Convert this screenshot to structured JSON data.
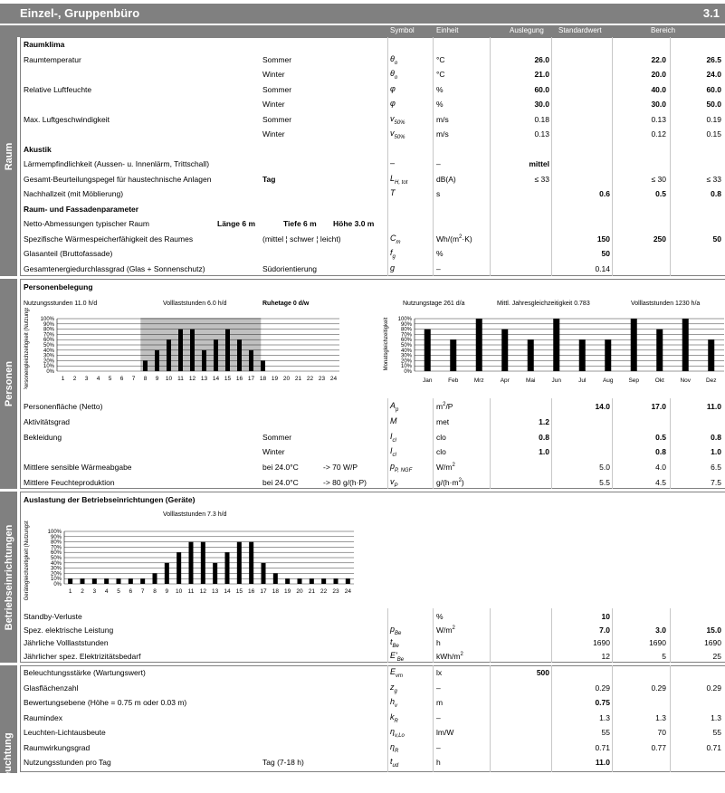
{
  "title": "Einzel-, Gruppenbüro",
  "number": "3.1",
  "headers": {
    "symbol": "Symbol",
    "einheit": "Einheit",
    "auslegung": "Auslegung",
    "standard": "Standardwert",
    "bereich": "Bereich"
  },
  "sides": [
    "Raum",
    "Personen",
    "Betriebseinrichtungen",
    "Beleuchtung"
  ],
  "raum_rows": [
    {
      "label": "Raumklima",
      "bold": true
    },
    {
      "label": "Raumtemperatur",
      "sub": "Sommer",
      "sym": "θ o",
      "unit": "°C",
      "ausl": "26.0",
      "ausl_b": true,
      "lo": "22.0",
      "hi": "26.5",
      "rb": true
    },
    {
      "label": "",
      "sub": "Winter",
      "sym": "θ o",
      "unit": "°C",
      "ausl": "21.0",
      "ausl_b": true,
      "lo": "20.0",
      "hi": "24.0",
      "rb": true
    },
    {
      "label": "Relative Luftfeuchte",
      "sub": "Sommer",
      "sym": "φ",
      "unit": "%",
      "ausl": "60.0",
      "ausl_b": true,
      "lo": "40.0",
      "hi": "60.0",
      "rb": true
    },
    {
      "label": "",
      "sub": "Winter",
      "sym": "φ",
      "unit": "%",
      "ausl": "30.0",
      "ausl_b": true,
      "lo": "30.0",
      "hi": "50.0",
      "rb": true
    },
    {
      "label": "Max. Luftgeschwindigkeit",
      "sub": "Sommer",
      "sym": "v 50%",
      "unit": "m/s",
      "ausl": "0.18",
      "lo": "0.13",
      "hi": "0.19"
    },
    {
      "label": "",
      "sub": "Winter",
      "sym": "v 50%",
      "unit": "m/s",
      "ausl": "0.13",
      "lo": "0.12",
      "hi": "0.15"
    },
    {
      "label": "Akustik",
      "bold": true
    },
    {
      "label": "Lärmempfindlichkeit (Aussen- u. Innenlärm, Trittschall)",
      "sym": "–",
      "unit": "–",
      "ausl": "mittel",
      "ausl_b": true
    },
    {
      "label": "Gesamt-Beurteilungspegel für haustechnische Anlagen",
      "sub2": "Tag",
      "sym": "L H, tot",
      "unit": "dB(A)",
      "ausl": "≤ 33",
      "lo": "≤ 30",
      "hi": "≤ 33"
    },
    {
      "label": "Nachhallzeit (mit Möblierung)",
      "sym": "T",
      "unit": "s",
      "std": "0.6",
      "lo": "0.5",
      "hi": "0.8",
      "rb": true,
      "stdb": true
    },
    {
      "label": "Raum- und Fassadenparameter",
      "bold": true
    },
    {
      "label": "Netto-Abmessungen typischer Raum",
      "dims": [
        "Länge 6 m",
        "Tiefe 6 m",
        "Höhe 3.0 m"
      ]
    },
    {
      "label": "Spezifische Wärmespeicherfähigkeit des Raumes",
      "sub": "(mittel ¦ schwer ¦ leicht)",
      "sym": "C m",
      "unit": "Wh/(m²·K)",
      "std": "150",
      "lo": "250",
      "hi": "50",
      "rb": true,
      "stdb": true
    },
    {
      "label": "Glasanteil  (Bruttofassade)",
      "sym": "f g",
      "unit": "%",
      "std": "50",
      "stdb": true
    },
    {
      "label": "Gesamtenergiedurchlassgrad (Glas + Sonnenschutz)",
      "sub": "Südorientierung",
      "sym": "g",
      "unit": "–",
      "std": "0.14"
    }
  ],
  "personen": {
    "heading": "Personenbelegung",
    "info_left": [
      "Nutzungsstunden 11.0 h/d",
      "Volllaststunden 6.0 h/d",
      "Ruhetage  0  d/w"
    ],
    "info_right": [
      "Nutzungstage 261 d/a",
      "Mittl. Jahresgleichzeitigkeit 0.783",
      "Volllaststunden 1230 h/a"
    ],
    "rows": [
      {
        "label": "Personenfläche (Netto)",
        "sym": "A p",
        "unit": "m²/P",
        "std": "14.0",
        "lo": "17.0",
        "hi": "11.0",
        "allb": true
      },
      {
        "label": "Aktivitätsgrad",
        "sym": "M",
        "unit": "met",
        "ausl": "1.2",
        "ausl_b": true
      },
      {
        "label": "Bekleidung",
        "sub": "Sommer",
        "sym": "I cl",
        "unit": "clo",
        "ausl": "0.8",
        "ausl_b": true,
        "lo": "0.5",
        "hi": "0.8",
        "rb": true
      },
      {
        "label": "",
        "sub": "Winter",
        "sym": "I cl",
        "unit": "clo",
        "ausl": "1.0",
        "ausl_b": true,
        "lo": "0.8",
        "hi": "1.0",
        "rb": true
      },
      {
        "label": "Mittlere sensible Wärmeabgabe",
        "cond": "bei 24.0°C",
        "arrow": "->  70 W/P",
        "sym": "p P, NGF",
        "unit": "W/m²",
        "std": "5.0",
        "lo": "4.0",
        "hi": "6.5"
      },
      {
        "label": "Mittlere Feuchteproduktion",
        "cond": "bei 24.0°C",
        "arrow": "->  80 g/(h·P)",
        "sym": "v P",
        "unit": "g/(h·m²)",
        "std": "5.5",
        "lo": "4.5",
        "hi": "7.5"
      }
    ]
  },
  "geraete": {
    "heading": "Auslastung der Betriebseinrichtungen (Geräte)",
    "info": "Volllaststunden 7.3 h/d",
    "rows": [
      {
        "label": "Standby-Verluste",
        "unit": "%",
        "std": "10",
        "stdb": true
      },
      {
        "label": "Spez. elektrische Leistung",
        "sym": "p Be",
        "unit": "W/m²",
        "std": "7.0",
        "lo": "3.0",
        "hi": "15.0",
        "allb": true
      },
      {
        "label": "Jährliche Volllaststunden",
        "sym": "t Be",
        "unit": "h",
        "std": "1690",
        "lo": "1690",
        "hi": "1690"
      },
      {
        "label": "Jährlicher spez. Elektrizitätsbedarf",
        "sym": "E' Be",
        "unit": "kWh/m²",
        "std": "12",
        "lo": "5",
        "hi": "25"
      }
    ]
  },
  "licht": {
    "rows": [
      {
        "label": "Beleuchtungsstärke (Wartungswert)",
        "sym": "E vm",
        "unit": "lx",
        "ausl": "500",
        "ausl_b": true
      },
      {
        "label": "Glasflächenzahl",
        "sym": "z g",
        "unit": "–",
        "std": "0.29",
        "lo": "0.29",
        "hi": "0.29"
      },
      {
        "label": "Bewertungsebene (Höhe = 0.75 m oder 0.03 m)",
        "sym": "h v",
        "unit": "m",
        "std": "0.75",
        "stdb": true
      },
      {
        "label": "Raumindex",
        "sym": "k R",
        "unit": "–",
        "std": "1.3",
        "lo": "1.3",
        "hi": "1.3"
      },
      {
        "label": "Leuchten-Lichtausbeute",
        "sym": "η v,Lo",
        "unit": "lm/W",
        "std": "55",
        "lo": "70",
        "hi": "55"
      },
      {
        "label": "Raumwirkungsgrad",
        "sym": "η R",
        "unit": "–",
        "std": "0.71",
        "lo": "0.77",
        "hi": "0.71"
      },
      {
        "label": "Nutzungsstunden pro Tag",
        "sub": "Tag (7-18 h)",
        "sym": "t ud",
        "unit": "h",
        "std": "11.0",
        "stdb": true
      }
    ]
  },
  "chart_data": [
    {
      "type": "bar",
      "ylabel": "Personengleichzeitigkeit (Nutzungstag)",
      "categories": [
        "1",
        "2",
        "3",
        "4",
        "5",
        "6",
        "7",
        "8",
        "9",
        "10",
        "11",
        "12",
        "13",
        "14",
        "15",
        "16",
        "17",
        "18",
        "19",
        "20",
        "21",
        "22",
        "23",
        "24"
      ],
      "values": [
        0,
        0,
        0,
        0,
        0,
        0,
        0,
        20,
        40,
        60,
        80,
        80,
        40,
        60,
        80,
        60,
        40,
        20,
        0,
        0,
        0,
        0,
        0,
        0
      ],
      "yticks": [
        "0%",
        "10%",
        "20%",
        "30%",
        "40%",
        "50%",
        "60%",
        "70%",
        "80%",
        "90%",
        "100%"
      ],
      "shade": [
        8,
        18
      ]
    },
    {
      "type": "bar",
      "ylabel": "Monatsgleichzeitigkeit",
      "categories": [
        "Jan",
        "Feb",
        "Mrz",
        "Apr",
        "Mai",
        "Jun",
        "Jul",
        "Aug",
        "Sep",
        "Okt",
        "Nov",
        "Dez"
      ],
      "values": [
        80,
        60,
        100,
        80,
        60,
        100,
        60,
        60,
        100,
        80,
        100,
        60
      ],
      "yticks": [
        "0%",
        "10%",
        "20%",
        "30%",
        "40%",
        "50%",
        "60%",
        "70%",
        "80%",
        "90%",
        "100%"
      ]
    },
    {
      "type": "bar",
      "ylabel": "Gerätegleichzeitigkeit (Nutzungstag)",
      "categories": [
        "1",
        "2",
        "3",
        "4",
        "5",
        "6",
        "7",
        "8",
        "9",
        "10",
        "11",
        "12",
        "13",
        "14",
        "15",
        "16",
        "17",
        "18",
        "19",
        "20",
        "21",
        "22",
        "23",
        "24"
      ],
      "values": [
        10,
        10,
        10,
        10,
        10,
        10,
        10,
        20,
        40,
        60,
        80,
        80,
        40,
        60,
        80,
        80,
        40,
        20,
        10,
        10,
        10,
        10,
        10,
        10
      ],
      "yticks": [
        "0%",
        "10%",
        "20%",
        "30%",
        "40%",
        "50%",
        "60%",
        "70%",
        "80%",
        "90%",
        "100%"
      ]
    }
  ]
}
